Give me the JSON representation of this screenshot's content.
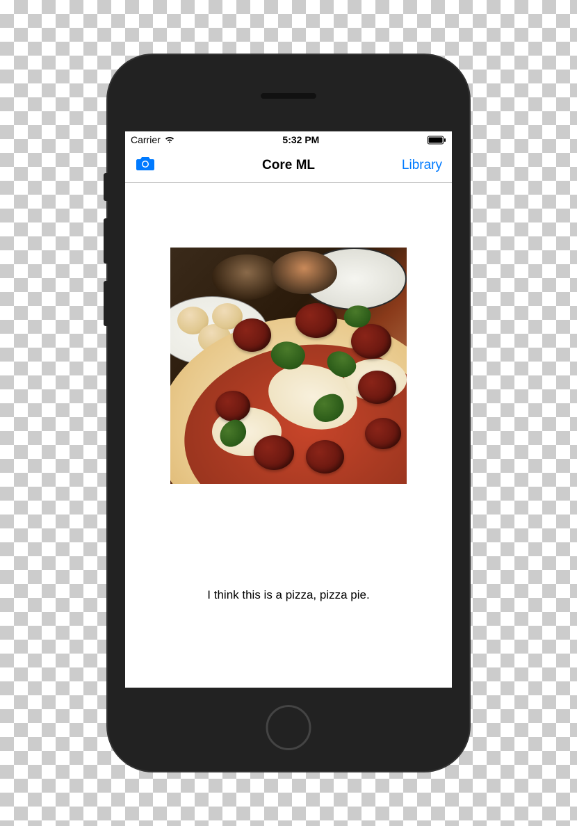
{
  "status_bar": {
    "carrier": "Carrier",
    "time": "5:32 PM"
  },
  "nav": {
    "title": "Core ML",
    "right_button": "Library"
  },
  "result": {
    "text": "I think this is a pizza, pizza pie."
  },
  "colors": {
    "ios_blue": "#007AFF"
  }
}
